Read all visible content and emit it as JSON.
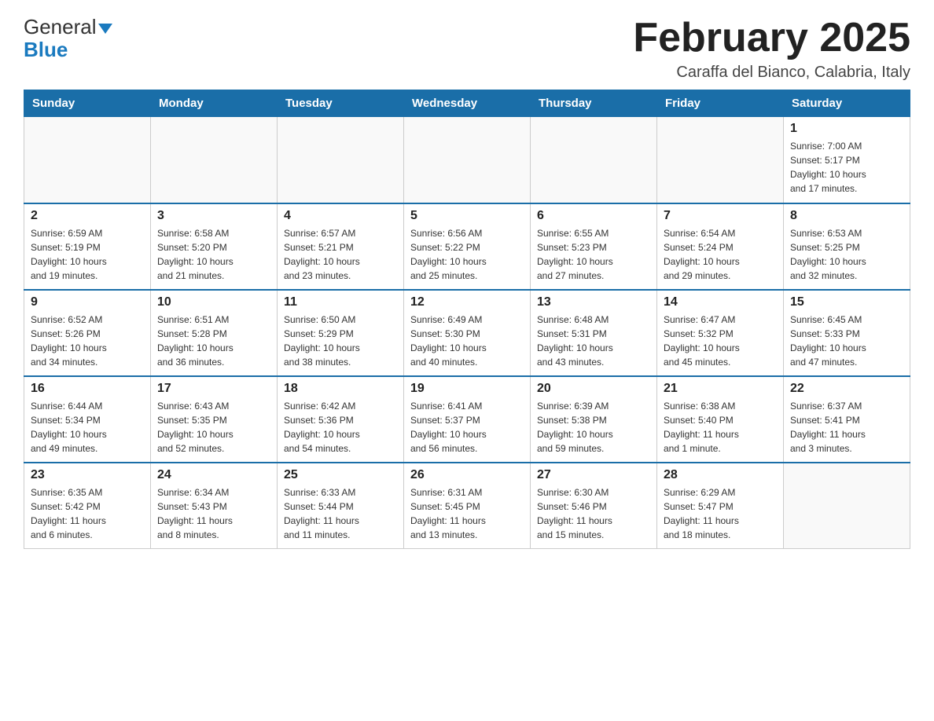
{
  "header": {
    "logo_general": "General",
    "logo_blue": "Blue",
    "month_title": "February 2025",
    "location": "Caraffa del Bianco, Calabria, Italy"
  },
  "weekdays": [
    "Sunday",
    "Monday",
    "Tuesday",
    "Wednesday",
    "Thursday",
    "Friday",
    "Saturday"
  ],
  "weeks": [
    [
      {
        "day": "",
        "info": ""
      },
      {
        "day": "",
        "info": ""
      },
      {
        "day": "",
        "info": ""
      },
      {
        "day": "",
        "info": ""
      },
      {
        "day": "",
        "info": ""
      },
      {
        "day": "",
        "info": ""
      },
      {
        "day": "1",
        "info": "Sunrise: 7:00 AM\nSunset: 5:17 PM\nDaylight: 10 hours\nand 17 minutes."
      }
    ],
    [
      {
        "day": "2",
        "info": "Sunrise: 6:59 AM\nSunset: 5:19 PM\nDaylight: 10 hours\nand 19 minutes."
      },
      {
        "day": "3",
        "info": "Sunrise: 6:58 AM\nSunset: 5:20 PM\nDaylight: 10 hours\nand 21 minutes."
      },
      {
        "day": "4",
        "info": "Sunrise: 6:57 AM\nSunset: 5:21 PM\nDaylight: 10 hours\nand 23 minutes."
      },
      {
        "day": "5",
        "info": "Sunrise: 6:56 AM\nSunset: 5:22 PM\nDaylight: 10 hours\nand 25 minutes."
      },
      {
        "day": "6",
        "info": "Sunrise: 6:55 AM\nSunset: 5:23 PM\nDaylight: 10 hours\nand 27 minutes."
      },
      {
        "day": "7",
        "info": "Sunrise: 6:54 AM\nSunset: 5:24 PM\nDaylight: 10 hours\nand 29 minutes."
      },
      {
        "day": "8",
        "info": "Sunrise: 6:53 AM\nSunset: 5:25 PM\nDaylight: 10 hours\nand 32 minutes."
      }
    ],
    [
      {
        "day": "9",
        "info": "Sunrise: 6:52 AM\nSunset: 5:26 PM\nDaylight: 10 hours\nand 34 minutes."
      },
      {
        "day": "10",
        "info": "Sunrise: 6:51 AM\nSunset: 5:28 PM\nDaylight: 10 hours\nand 36 minutes."
      },
      {
        "day": "11",
        "info": "Sunrise: 6:50 AM\nSunset: 5:29 PM\nDaylight: 10 hours\nand 38 minutes."
      },
      {
        "day": "12",
        "info": "Sunrise: 6:49 AM\nSunset: 5:30 PM\nDaylight: 10 hours\nand 40 minutes."
      },
      {
        "day": "13",
        "info": "Sunrise: 6:48 AM\nSunset: 5:31 PM\nDaylight: 10 hours\nand 43 minutes."
      },
      {
        "day": "14",
        "info": "Sunrise: 6:47 AM\nSunset: 5:32 PM\nDaylight: 10 hours\nand 45 minutes."
      },
      {
        "day": "15",
        "info": "Sunrise: 6:45 AM\nSunset: 5:33 PM\nDaylight: 10 hours\nand 47 minutes."
      }
    ],
    [
      {
        "day": "16",
        "info": "Sunrise: 6:44 AM\nSunset: 5:34 PM\nDaylight: 10 hours\nand 49 minutes."
      },
      {
        "day": "17",
        "info": "Sunrise: 6:43 AM\nSunset: 5:35 PM\nDaylight: 10 hours\nand 52 minutes."
      },
      {
        "day": "18",
        "info": "Sunrise: 6:42 AM\nSunset: 5:36 PM\nDaylight: 10 hours\nand 54 minutes."
      },
      {
        "day": "19",
        "info": "Sunrise: 6:41 AM\nSunset: 5:37 PM\nDaylight: 10 hours\nand 56 minutes."
      },
      {
        "day": "20",
        "info": "Sunrise: 6:39 AM\nSunset: 5:38 PM\nDaylight: 10 hours\nand 59 minutes."
      },
      {
        "day": "21",
        "info": "Sunrise: 6:38 AM\nSunset: 5:40 PM\nDaylight: 11 hours\nand 1 minute."
      },
      {
        "day": "22",
        "info": "Sunrise: 6:37 AM\nSunset: 5:41 PM\nDaylight: 11 hours\nand 3 minutes."
      }
    ],
    [
      {
        "day": "23",
        "info": "Sunrise: 6:35 AM\nSunset: 5:42 PM\nDaylight: 11 hours\nand 6 minutes."
      },
      {
        "day": "24",
        "info": "Sunrise: 6:34 AM\nSunset: 5:43 PM\nDaylight: 11 hours\nand 8 minutes."
      },
      {
        "day": "25",
        "info": "Sunrise: 6:33 AM\nSunset: 5:44 PM\nDaylight: 11 hours\nand 11 minutes."
      },
      {
        "day": "26",
        "info": "Sunrise: 6:31 AM\nSunset: 5:45 PM\nDaylight: 11 hours\nand 13 minutes."
      },
      {
        "day": "27",
        "info": "Sunrise: 6:30 AM\nSunset: 5:46 PM\nDaylight: 11 hours\nand 15 minutes."
      },
      {
        "day": "28",
        "info": "Sunrise: 6:29 AM\nSunset: 5:47 PM\nDaylight: 11 hours\nand 18 minutes."
      },
      {
        "day": "",
        "info": ""
      }
    ]
  ]
}
